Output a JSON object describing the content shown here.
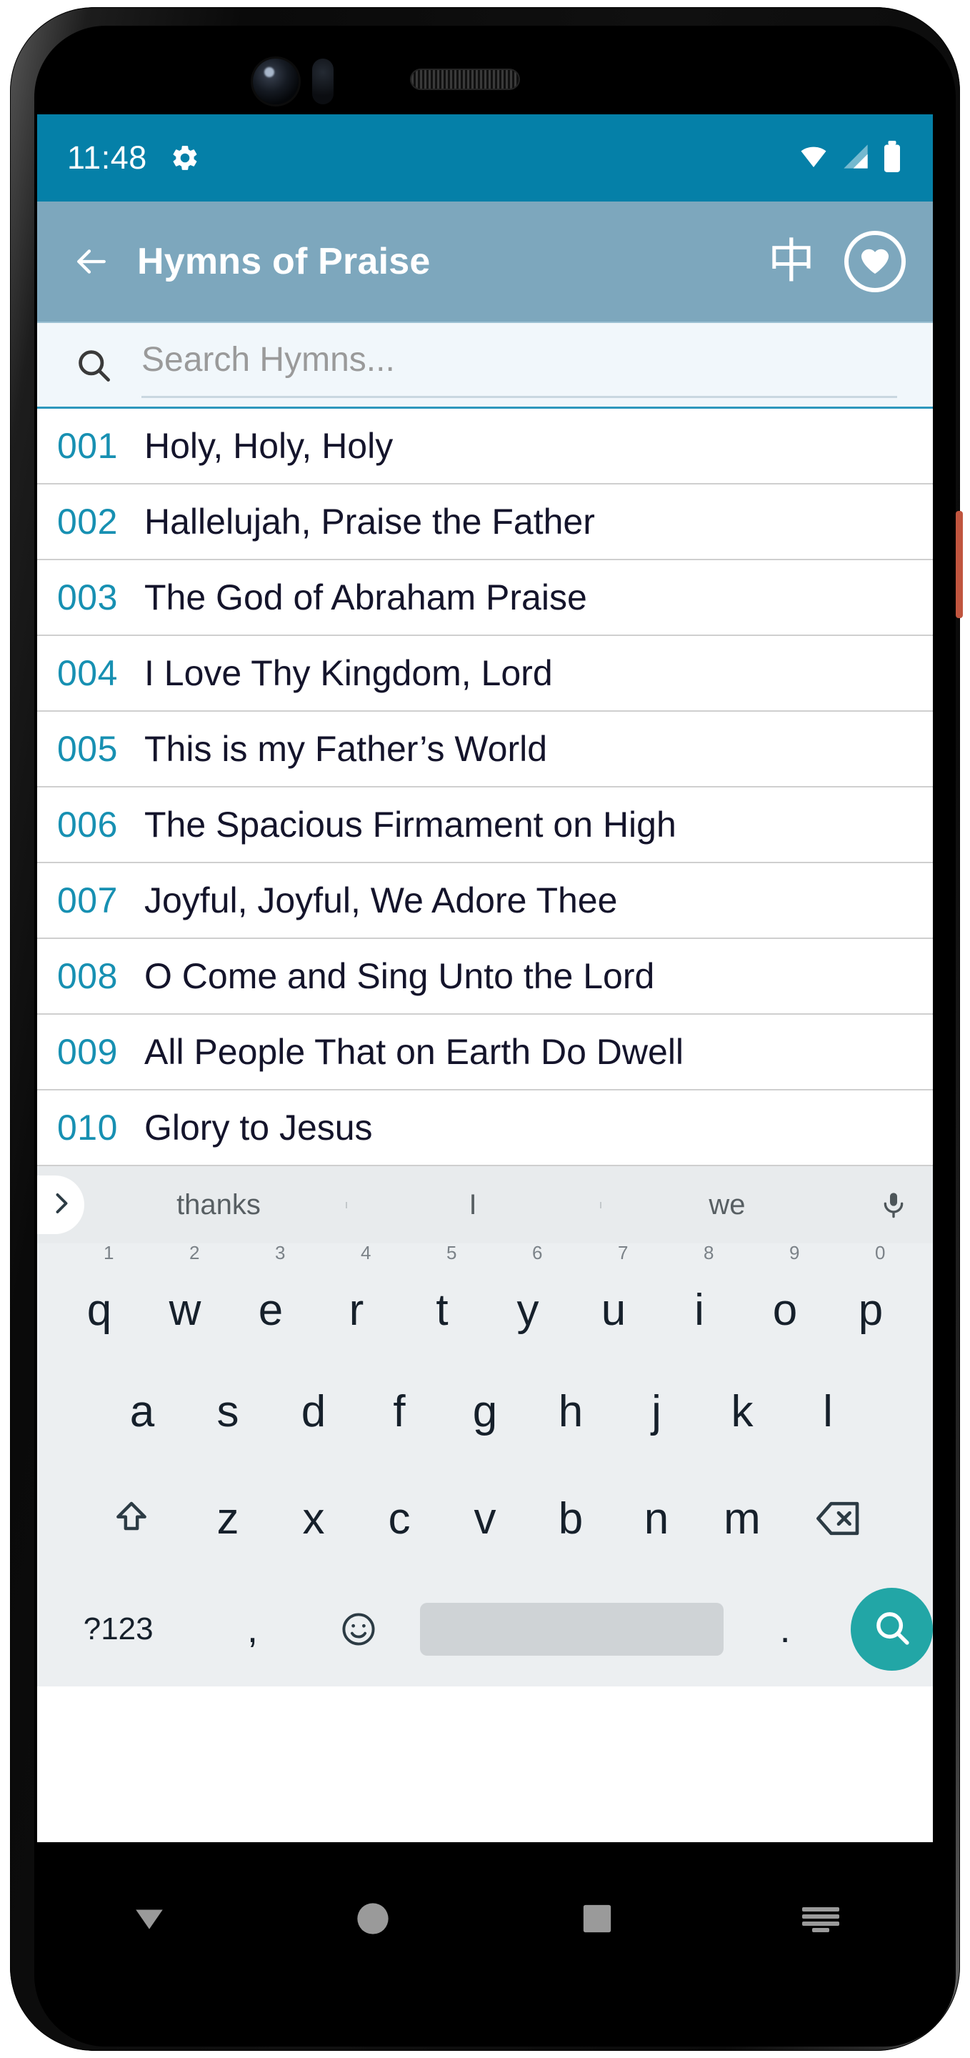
{
  "status_bar": {
    "time": "11:48",
    "icons": [
      "gear-icon",
      "wifi-icon",
      "cellular-signal-icon",
      "battery-icon"
    ],
    "background_color": "#0580A8"
  },
  "app_bar": {
    "back_icon": "arrow-left-icon",
    "title": "Hymns of Praise",
    "language_toggle_label": "中",
    "favorites_icon": "heart-icon",
    "background_color": "#7DA7BD"
  },
  "search": {
    "icon": "magnifier-icon",
    "value": "",
    "placeholder": "Search Hymns...",
    "underline_color": "#2D97BD"
  },
  "hymn_list": {
    "number_color": "#1790B2",
    "title_color": "#14142B",
    "items": [
      {
        "number": "001",
        "title": "Holy, Holy, Holy"
      },
      {
        "number": "002",
        "title": "Hallelujah, Praise the Father"
      },
      {
        "number": "003",
        "title": "The God of Abraham Praise"
      },
      {
        "number": "004",
        "title": "I Love Thy Kingdom, Lord"
      },
      {
        "number": "005",
        "title": "This is my Father’s World"
      },
      {
        "number": "006",
        "title": "The Spacious Firmament on High"
      },
      {
        "number": "007",
        "title": "Joyful, Joyful, We Adore Thee"
      },
      {
        "number": "008",
        "title": "O Come and Sing Unto the Lord"
      },
      {
        "number": "009",
        "title": "All People That on Earth Do Dwell"
      },
      {
        "number": "010",
        "title": "Glory to Jesus"
      }
    ]
  },
  "keyboard": {
    "suggestions": [
      "thanks",
      "I",
      "we"
    ],
    "expand_icon": "chevron-right-icon",
    "mic_icon": "microphone-icon",
    "row_1": [
      {
        "key": "q",
        "hint": "1"
      },
      {
        "key": "w",
        "hint": "2"
      },
      {
        "key": "e",
        "hint": "3"
      },
      {
        "key": "r",
        "hint": "4"
      },
      {
        "key": "t",
        "hint": "5"
      },
      {
        "key": "y",
        "hint": "6"
      },
      {
        "key": "u",
        "hint": "7"
      },
      {
        "key": "i",
        "hint": "8"
      },
      {
        "key": "o",
        "hint": "9"
      },
      {
        "key": "p",
        "hint": "0"
      }
    ],
    "row_2": [
      "a",
      "s",
      "d",
      "f",
      "g",
      "h",
      "j",
      "k",
      "l"
    ],
    "row_3": [
      "z",
      "x",
      "c",
      "v",
      "b",
      "n",
      "m"
    ],
    "shift_icon": "shift-arrow-icon",
    "backspace_icon": "backspace-icon",
    "symbols_label": "?123",
    "comma_label": ",",
    "emoji_icon": "emoji-smiley-icon",
    "space_label": "",
    "period_label": ".",
    "search_key_icon": "magnifier-icon",
    "search_key_color": "#22A6A6"
  },
  "nav_bar": {
    "back_icon": "triangle-down-icon",
    "home_icon": "circle-icon",
    "recents_icon": "square-icon",
    "keyboard_icon": "keyboard-dismiss-icon"
  }
}
